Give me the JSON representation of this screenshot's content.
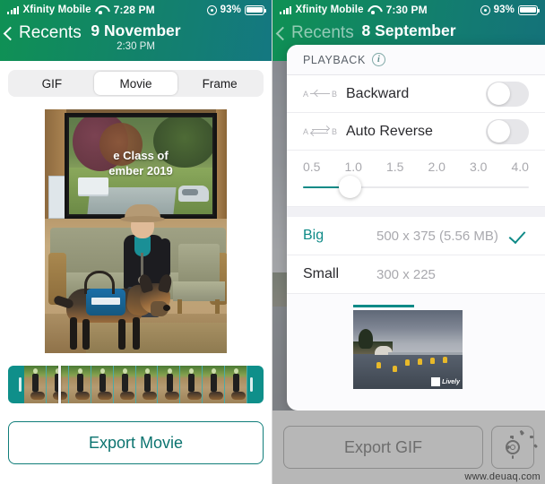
{
  "left": {
    "status": {
      "carrier": "Xfinity Mobile",
      "time": "7:28 PM",
      "battery": "93%",
      "signal_icon": "signal-bars-icon",
      "wifi_icon": "wifi-icon",
      "location_icon": "location-services-icon",
      "battery_icon": "battery-icon"
    },
    "nav": {
      "back_label": "Recents",
      "back_icon": "chevron-left-icon",
      "title": "9 November",
      "subtitle": "2:30 PM"
    },
    "segmented": {
      "options": [
        "GIF",
        "Movie",
        "Frame"
      ],
      "selected": "Movie"
    },
    "photo": {
      "overlay_line1": "e Class of",
      "overlay_line2": "ember 2019"
    },
    "export_label": "Export Movie"
  },
  "right": {
    "status": {
      "carrier": "Xfinity Mobile",
      "time": "7:30 PM",
      "battery": "93%"
    },
    "nav": {
      "back_label": "Recents",
      "title": "8 September"
    },
    "modal": {
      "header": "PLAYBACK",
      "info_icon": "info-circle-icon",
      "rows": [
        {
          "label": "Backward",
          "icon": "a-to-b-backward-icon",
          "value": "off"
        },
        {
          "label": "Auto Reverse",
          "icon": "a-to-b-reverse-icon",
          "value": "off"
        }
      ],
      "speed": {
        "ticks": [
          "0.5",
          "1.0",
          "1.5",
          "2.0",
          "3.0",
          "4.0"
        ],
        "selected": "1.0"
      },
      "sizes": [
        {
          "name": "Big",
          "dimensions": "500 x 375 (5.56 MB)",
          "selected": true
        },
        {
          "name": "Small",
          "dimensions": "300 x 225",
          "selected": false
        }
      ],
      "check_icon": "checkmark-icon"
    },
    "preview": {
      "watermark": "Lively"
    },
    "export_label": "Export GIF",
    "gear_icon": "gear-icon",
    "pointer_icon": "arrow-down-icon"
  },
  "page_watermark": "www.deuaq.com",
  "colors": {
    "accent": "#0e8a87",
    "header_green": "#129053",
    "header_teal": "#13758f"
  }
}
